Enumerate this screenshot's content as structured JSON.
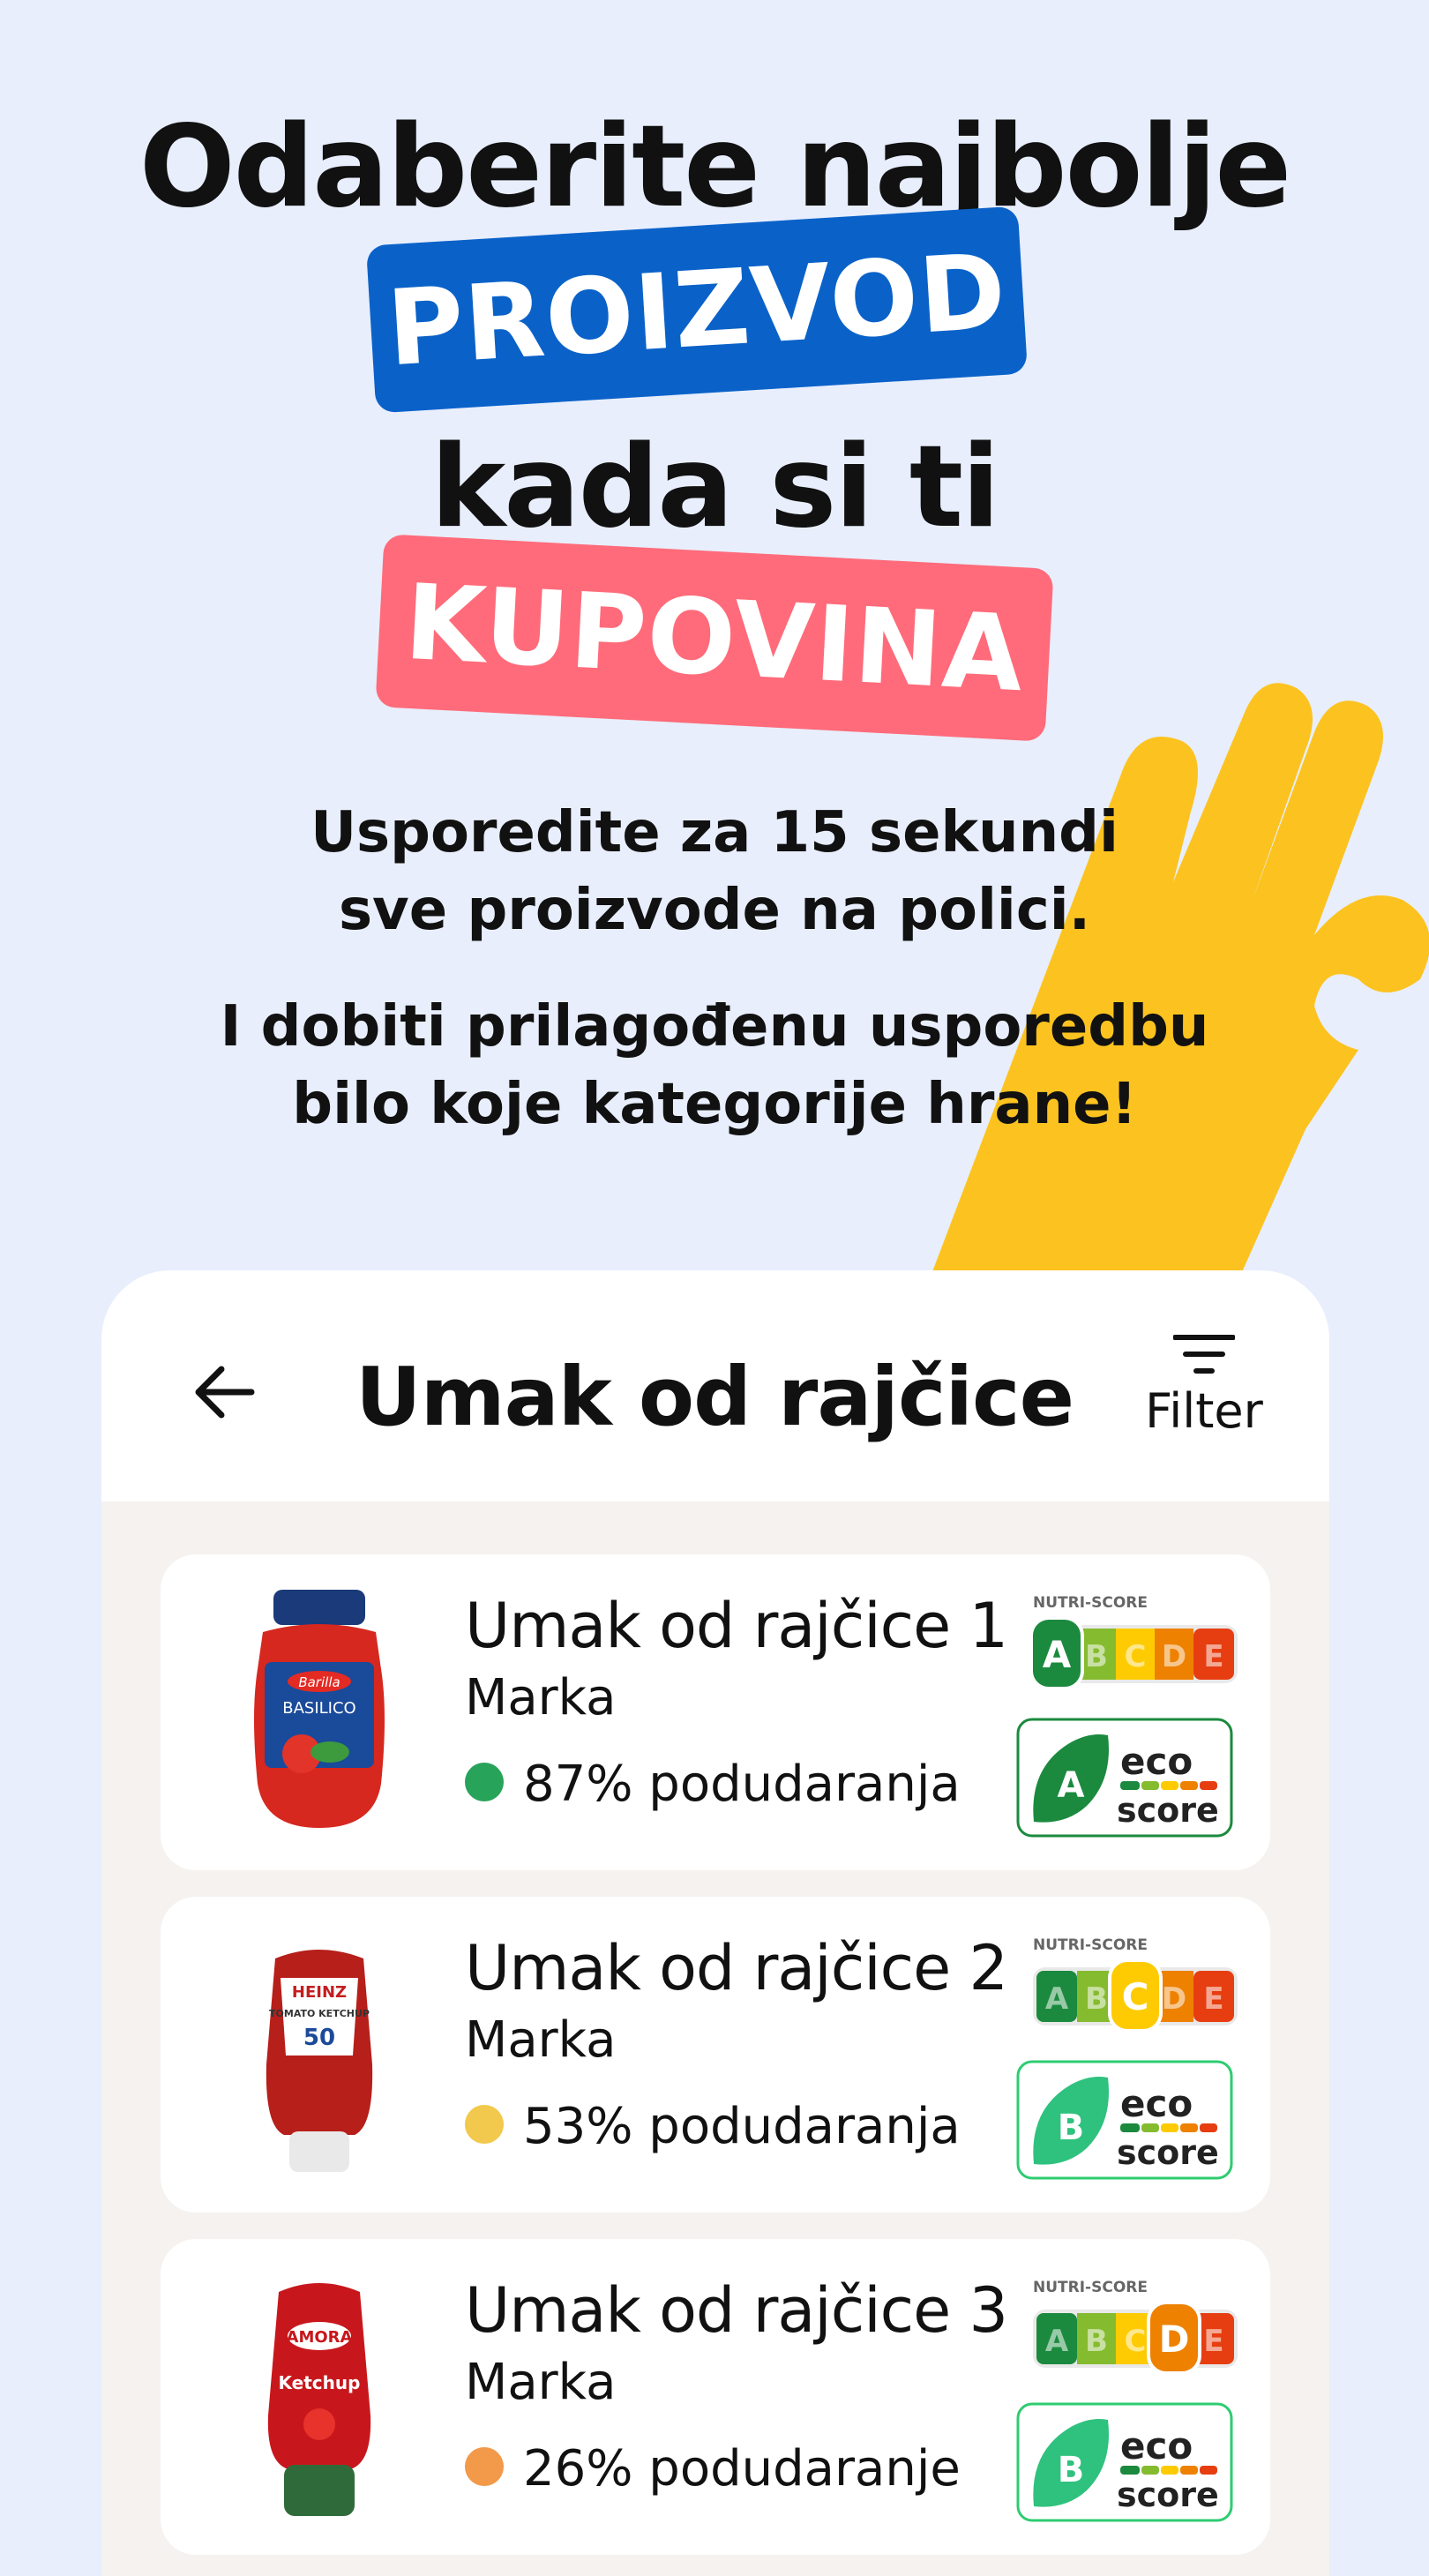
{
  "hero": {
    "line1": "Odaberite najbolje",
    "highlight1": "PROIZVOD",
    "line3": "kada si ti",
    "highlight2": "KUPOVINA",
    "sub1_a": "Usporedite za 15 sekundi",
    "sub1_b": "sve proizvode na polici.",
    "sub2_a": "I dobiti prilagođenu usporedbu",
    "sub2_b": "bilo koje kategorije hrane!"
  },
  "header": {
    "title": "Umak od rajčice",
    "filter_label": "Filter"
  },
  "products": [
    {
      "name": "Umak od rajčice 1",
      "brand": "Marka",
      "match": "87% podudaranja",
      "match_color": "#27a35a",
      "nutri_grade": "A",
      "eco_grade": "A",
      "label_text": "BASILICO",
      "brand_logo": "Barilla"
    },
    {
      "name": "Umak od rajčice 2",
      "brand": "Marka",
      "match": "53% podudaranja",
      "match_color": "#f2c94c",
      "nutri_grade": "C",
      "eco_grade": "B",
      "label_text": "TOMATO KETCHUP",
      "brand_logo": "HEINZ"
    },
    {
      "name": "Umak od rajčice 3",
      "brand": "Marka",
      "match": "26% podudaranje",
      "match_color": "#f2994a",
      "nutri_grade": "D",
      "eco_grade": "B",
      "label_text": "Ketchup",
      "brand_logo": "AMORA"
    }
  ],
  "score_labels": {
    "nutri": "NUTRI-SCORE",
    "eco_top": "eco",
    "eco_bottom": "score"
  },
  "colors": {
    "background": "#e8eefc",
    "blue_pill": "#0a62c9",
    "red_pill": "#ff6b7a",
    "hand": "#fcc320"
  }
}
